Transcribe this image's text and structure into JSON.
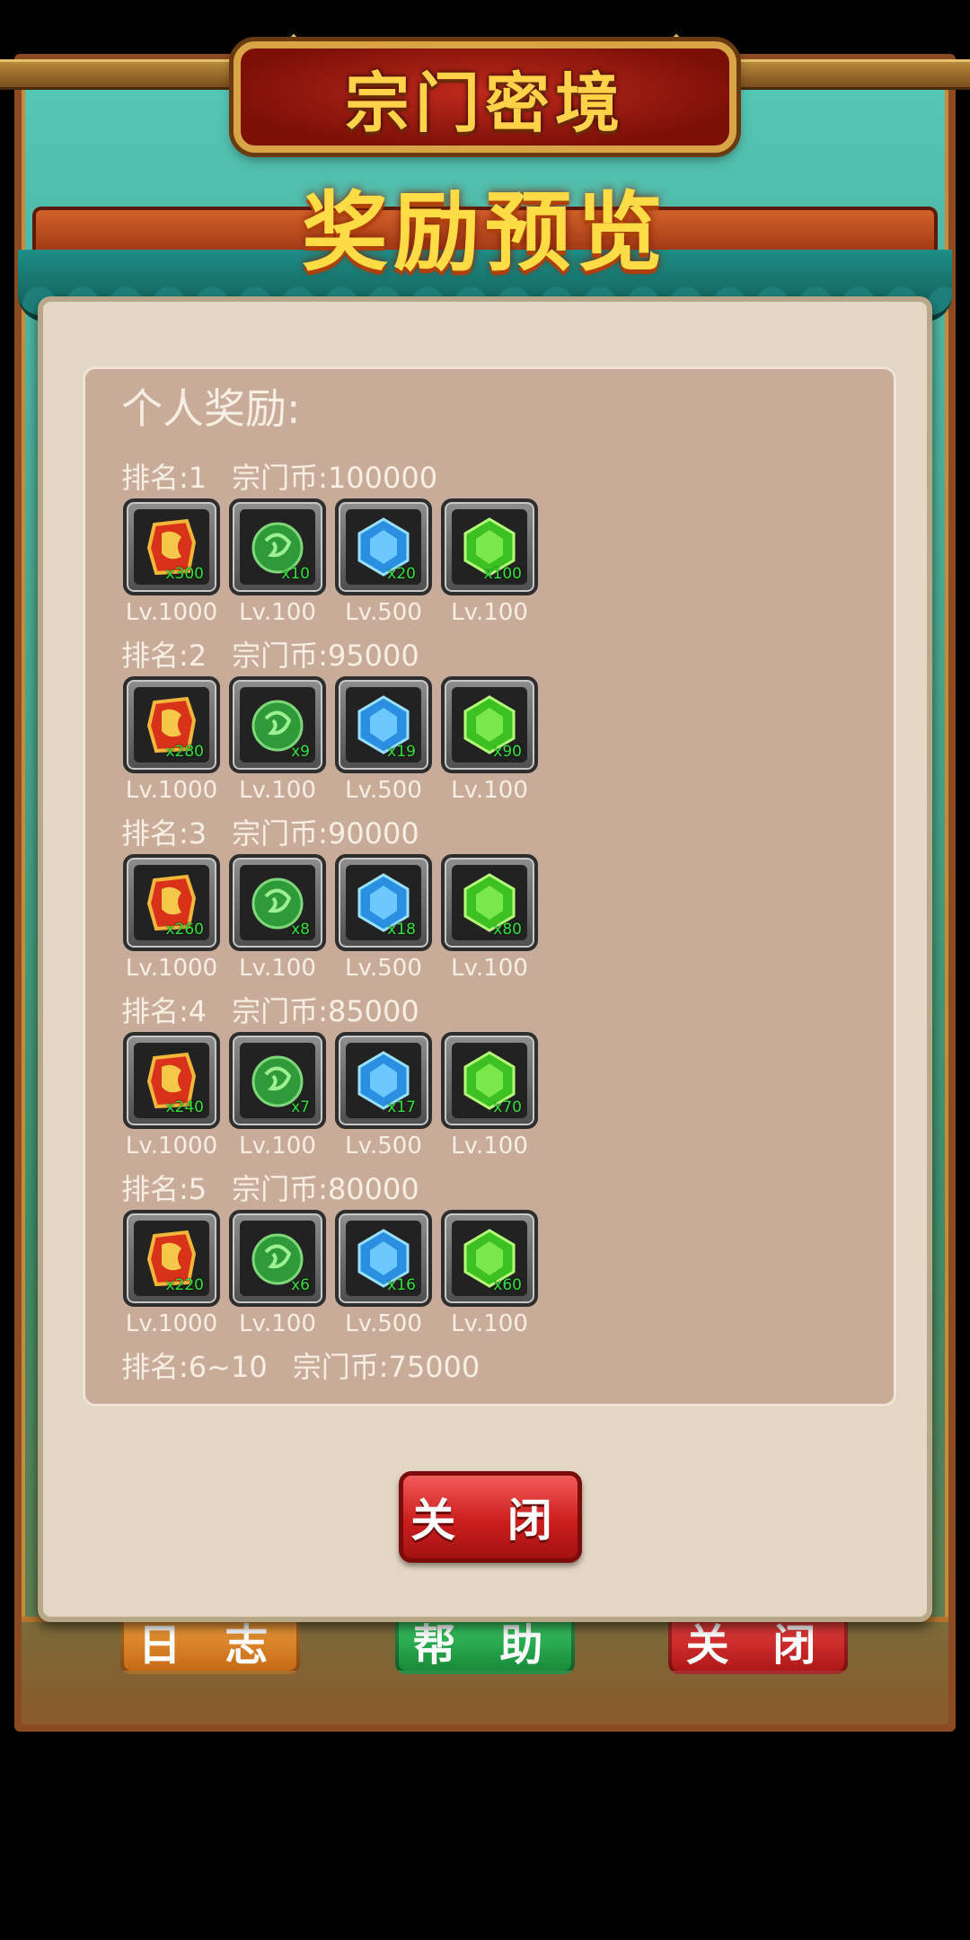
{
  "header": {
    "title": "宗门密境",
    "subtitle": "奖励预览"
  },
  "background_buttons": {
    "log": "日 志",
    "help": "帮 助",
    "close": "关 闭"
  },
  "dialog": {
    "section_title": "个人奖励:",
    "close_label": "关 闭",
    "ranks": [
      {
        "rank": "排名:1",
        "coins": "宗门币:100000",
        "items": [
          {
            "icon": "red-token-icon",
            "qty": "x300",
            "level": "Lv.1000"
          },
          {
            "icon": "jade-orb-icon",
            "qty": "x10",
            "level": "Lv.100"
          },
          {
            "icon": "blue-gem-icon",
            "qty": "x20",
            "level": "Lv.500"
          },
          {
            "icon": "green-gem-icon",
            "qty": "x100",
            "level": "Lv.100"
          }
        ]
      },
      {
        "rank": "排名:2",
        "coins": "宗门币:95000",
        "items": [
          {
            "icon": "red-token-icon",
            "qty": "x280",
            "level": "Lv.1000"
          },
          {
            "icon": "jade-orb-icon",
            "qty": "x9",
            "level": "Lv.100"
          },
          {
            "icon": "blue-gem-icon",
            "qty": "x19",
            "level": "Lv.500"
          },
          {
            "icon": "green-gem-icon",
            "qty": "x90",
            "level": "Lv.100"
          }
        ]
      },
      {
        "rank": "排名:3",
        "coins": "宗门币:90000",
        "items": [
          {
            "icon": "red-token-icon",
            "qty": "x260",
            "level": "Lv.1000"
          },
          {
            "icon": "jade-orb-icon",
            "qty": "x8",
            "level": "Lv.100"
          },
          {
            "icon": "blue-gem-icon",
            "qty": "x18",
            "level": "Lv.500"
          },
          {
            "icon": "green-gem-icon",
            "qty": "x80",
            "level": "Lv.100"
          }
        ]
      },
      {
        "rank": "排名:4",
        "coins": "宗门币:85000",
        "items": [
          {
            "icon": "red-token-icon",
            "qty": "x240",
            "level": "Lv.1000"
          },
          {
            "icon": "jade-orb-icon",
            "qty": "x7",
            "level": "Lv.100"
          },
          {
            "icon": "blue-gem-icon",
            "qty": "x17",
            "level": "Lv.500"
          },
          {
            "icon": "green-gem-icon",
            "qty": "x70",
            "level": "Lv.100"
          }
        ]
      },
      {
        "rank": "排名:5",
        "coins": "宗门币:80000",
        "items": [
          {
            "icon": "red-token-icon",
            "qty": "x220",
            "level": "Lv.1000"
          },
          {
            "icon": "jade-orb-icon",
            "qty": "x6",
            "level": "Lv.100"
          },
          {
            "icon": "blue-gem-icon",
            "qty": "x16",
            "level": "Lv.500"
          },
          {
            "icon": "green-gem-icon",
            "qty": "x60",
            "level": "Lv.100"
          }
        ]
      },
      {
        "rank": "排名:6~10",
        "coins": "宗门币:75000",
        "items": []
      }
    ]
  },
  "colors": {
    "dialog_bg": "#e3d6c2",
    "panel_bg": "#c9ab99",
    "qty_green": "#34e33a",
    "title_gold": "#ffd24a",
    "close_red": "#cc1e1e"
  }
}
